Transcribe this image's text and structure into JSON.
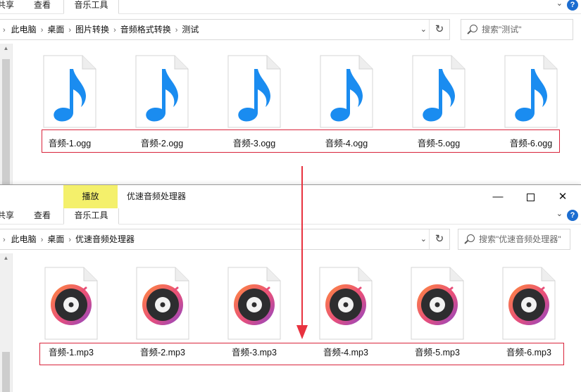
{
  "top_window": {
    "ribbon_tabs": {
      "share": "共享",
      "view": "查看",
      "music": "音乐工具"
    },
    "breadcrumb": [
      "此电脑",
      "桌面",
      "图片转换",
      "音频格式转换",
      "测试"
    ],
    "search_placeholder": "搜索\"测试\"",
    "files": [
      {
        "name": "音频-1.ogg"
      },
      {
        "name": "音频-2.ogg"
      },
      {
        "name": "音频-3.ogg"
      },
      {
        "name": "音频-4.ogg"
      },
      {
        "name": "音频-5.ogg"
      },
      {
        "name": "音频-6.ogg"
      }
    ]
  },
  "bottom_window": {
    "context_tab": "播放",
    "title": "优速音频处理器",
    "ribbon_tabs": {
      "share": "共享",
      "view": "查看",
      "music": "音乐工具"
    },
    "breadcrumb": [
      "此电脑",
      "桌面",
      "优速音频处理器"
    ],
    "search_placeholder": "搜索\"优速音频处理器\"",
    "files": [
      {
        "name": "音频-1.mp3"
      },
      {
        "name": "音频-2.mp3"
      },
      {
        "name": "音频-3.mp3"
      },
      {
        "name": "音频-4.mp3"
      },
      {
        "name": "音频-5.mp3"
      },
      {
        "name": "音频-6.mp3"
      }
    ]
  },
  "icons": {
    "ogg_file": "music-note-file-icon",
    "mp3_file": "vinyl-disc-file-icon",
    "search": "search-icon",
    "refresh": "refresh-icon",
    "help": "help-icon"
  },
  "colors": {
    "highlight_box": "#d9243b",
    "music_note": "#1a8cf0",
    "context_tab": "#f4f06b"
  }
}
